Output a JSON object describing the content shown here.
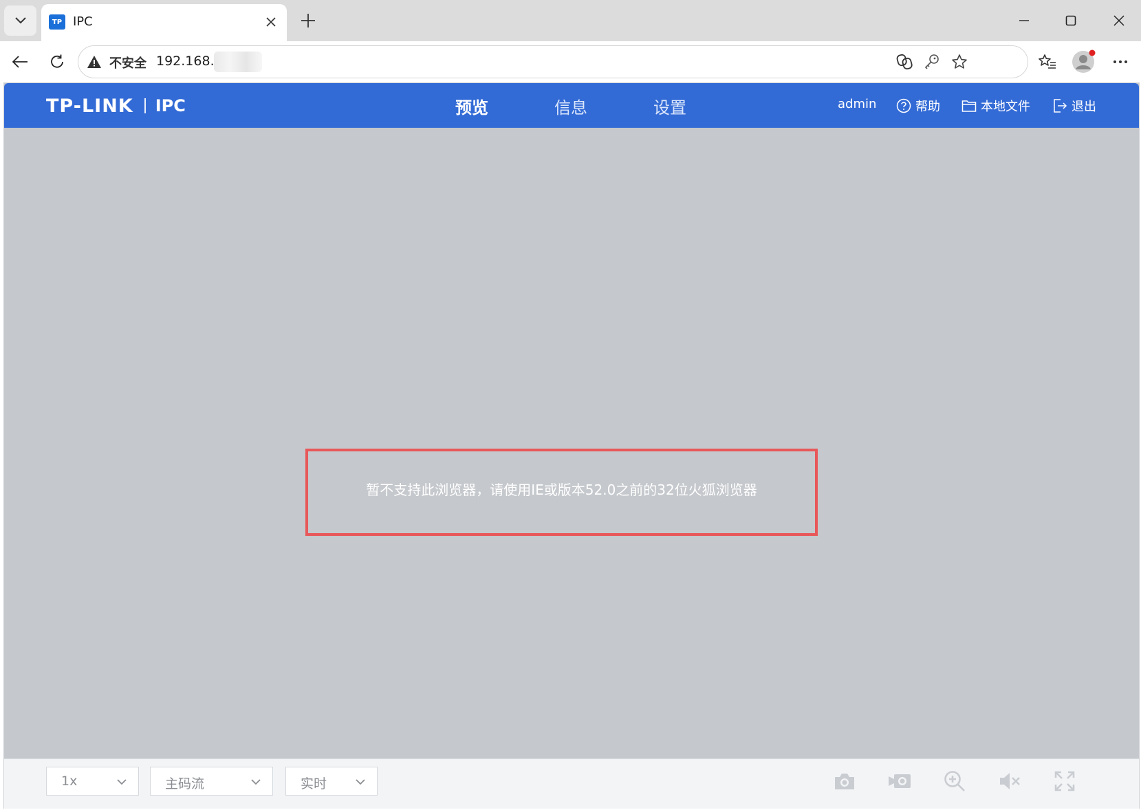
{
  "browser": {
    "tab": {
      "favicon_text": "TP",
      "title": "IPC"
    },
    "addressbar": {
      "security_label": "不安全",
      "url": "192.168."
    }
  },
  "app": {
    "logo": {
      "brand": "TP-LINK",
      "product": "IPC"
    },
    "nav": {
      "preview": "预览",
      "info": "信息",
      "settings": "设置"
    },
    "user": "admin",
    "help": "帮助",
    "local_files": "本地文件",
    "logout": "退出",
    "message": "暂不支持此浏览器，请使用IE或版本52.0之前的32位火狐浏览器",
    "controls": {
      "speed": "1x",
      "stream": "主码流",
      "mode": "实时"
    },
    "colors": {
      "header": "#336bd6",
      "video_bg": "#c5c8cc",
      "highlight_border": "#e8585a"
    }
  }
}
